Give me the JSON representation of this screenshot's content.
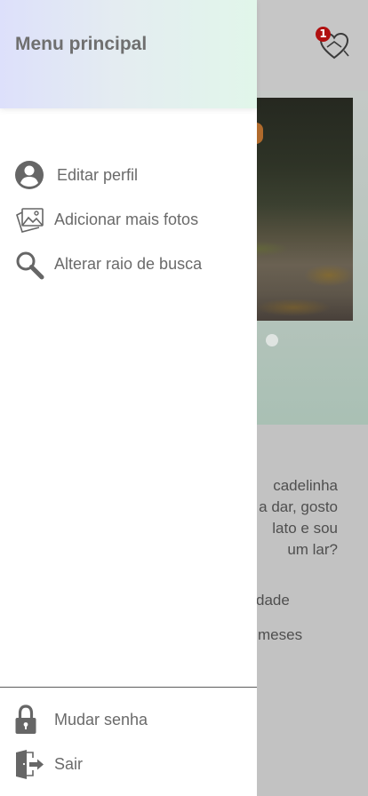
{
  "background": {
    "notification_count": "1",
    "description_fragment": "cadelinha\na dar, gosto\nlato e sou\num lar?",
    "line_1": "dade",
    "line_2": "meses"
  },
  "drawer": {
    "title": "Menu principal",
    "items": [
      {
        "label": "Editar perfil",
        "icon": "user-circle-icon"
      },
      {
        "label": "Adicionar mais fotos",
        "icon": "photos-icon"
      },
      {
        "label": "Alterar raio de busca",
        "icon": "search-icon"
      }
    ],
    "footer_items": [
      {
        "label": "Mudar senha",
        "icon": "lock-icon"
      },
      {
        "label": "Sair",
        "icon": "exit-door-icon"
      }
    ]
  },
  "colors": {
    "header_gradient_start": "#dde0fb",
    "header_gradient_end": "#e1f6ea",
    "badge": "#b01010",
    "icon": "#6a6a6a"
  }
}
